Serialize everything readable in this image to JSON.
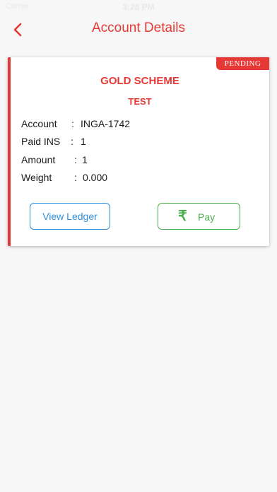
{
  "status_bar": {
    "carrier": "Carrier",
    "time": "3:28 PM"
  },
  "nav": {
    "back_icon": "chevron-left-icon",
    "title": "Account Details"
  },
  "card": {
    "badge": "PENDING",
    "scheme_name": "GOLD SCHEME",
    "scheme_subtitle": "TEST",
    "separator": ":",
    "details": [
      {
        "label": "Account",
        "value": "INGA-1742"
      },
      {
        "label": "Paid INS",
        "value": "1"
      },
      {
        "label": "Amount",
        "value": "1"
      },
      {
        "label": "Weight",
        "value": "0.000"
      }
    ],
    "ledger_button": "View Ledger",
    "pay_icon": "rupee-icon",
    "pay_symbol": "₹",
    "pay_button": "Pay"
  },
  "colors": {
    "accent": "#e53935",
    "link_blue": "#2f8fd8",
    "pay_green": "#4caf50",
    "background": "#f7f7f7"
  }
}
